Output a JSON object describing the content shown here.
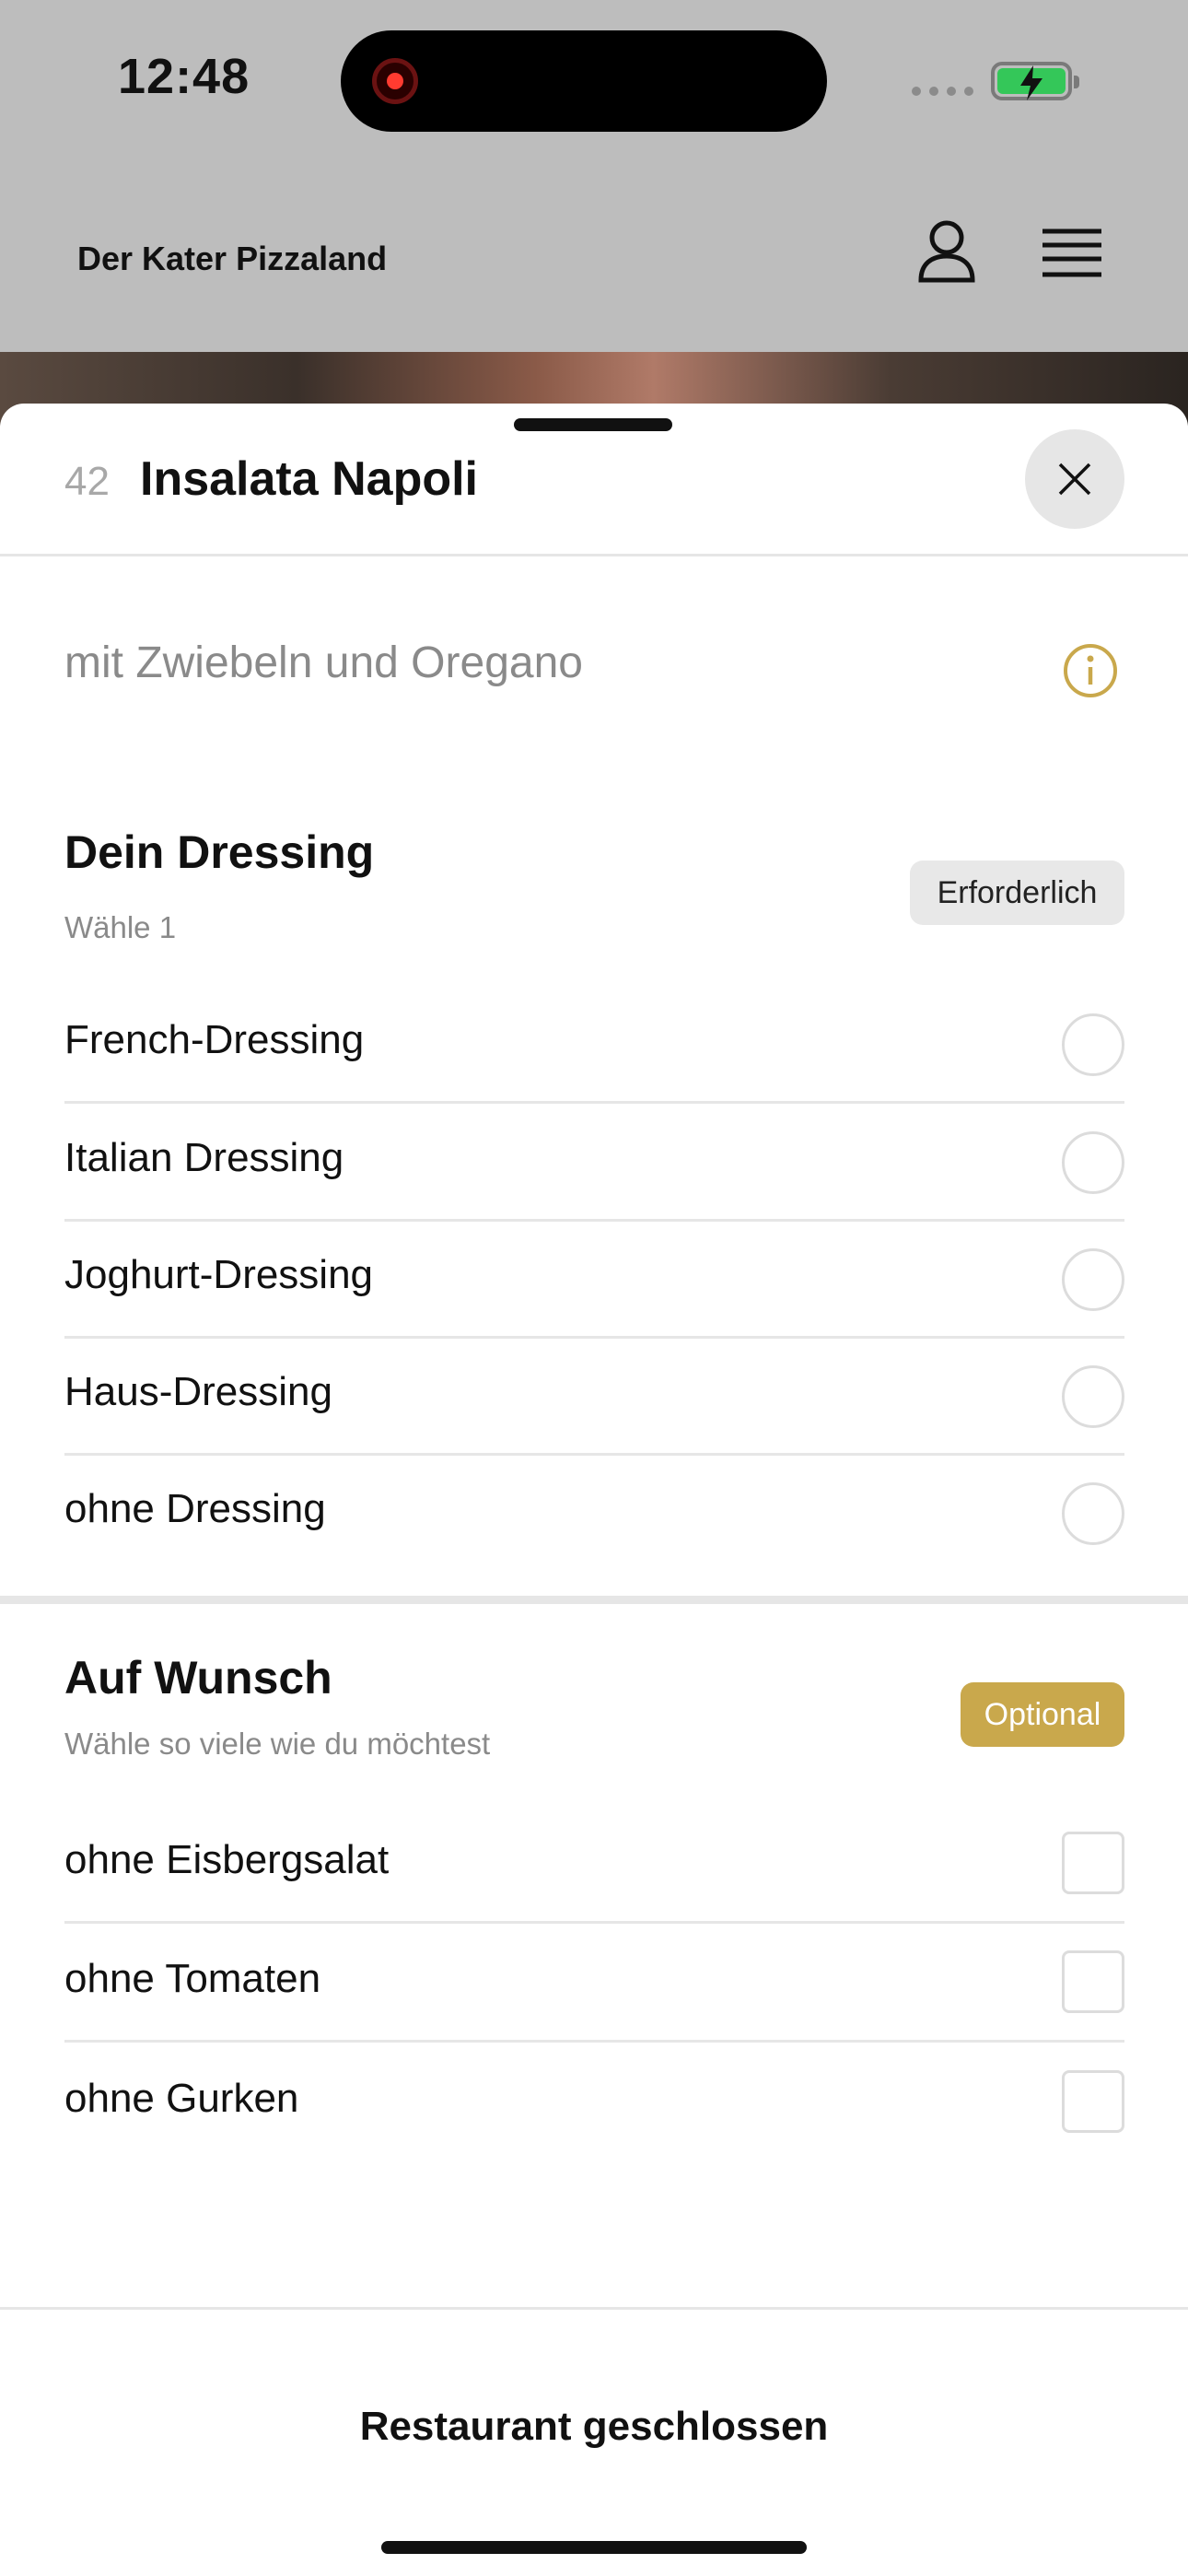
{
  "status_bar": {
    "time": "12:48"
  },
  "header": {
    "brand": "Der Kater Pizzaland"
  },
  "sheet": {
    "item_number": "42",
    "title": "Insalata Napoli",
    "description": "mit Zwiebeln und Oregano"
  },
  "dressing": {
    "title": "Dein Dressing",
    "subtitle": "Wähle 1",
    "badge": "Erforderlich",
    "options": [
      {
        "label": "French-Dressing",
        "selected": false
      },
      {
        "label": "Italian Dressing",
        "selected": false
      },
      {
        "label": "Joghurt-Dressing",
        "selected": false
      },
      {
        "label": "Haus-Dressing",
        "selected": false
      },
      {
        "label": "ohne Dressing",
        "selected": false
      }
    ]
  },
  "extras": {
    "title": "Auf Wunsch",
    "subtitle": "Wähle so viele wie du möchtest",
    "badge": "Optional",
    "options": [
      {
        "label": "ohne Eisbergsalat",
        "checked": false
      },
      {
        "label": "ohne Tomaten",
        "checked": false
      },
      {
        "label": "ohne Gurken",
        "checked": false
      }
    ]
  },
  "footer": {
    "status": "Restaurant geschlossen"
  },
  "colors": {
    "accent": "#c9a84c",
    "battery": "#34c759",
    "recording": "#ff3b30"
  },
  "icons": [
    "user-icon",
    "menu-icon",
    "close-icon",
    "info-icon",
    "battery-icon"
  ]
}
